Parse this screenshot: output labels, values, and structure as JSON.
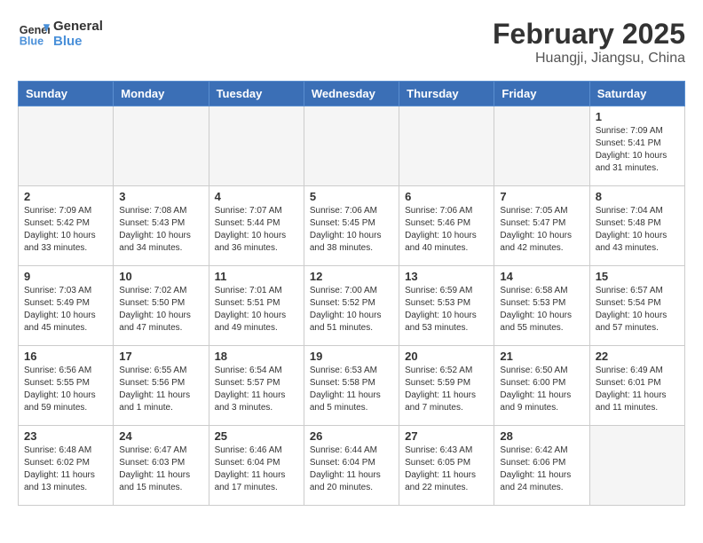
{
  "logo": {
    "line1": "General",
    "line2": "Blue"
  },
  "title": "February 2025",
  "subtitle": "Huangji, Jiangsu, China",
  "weekdays": [
    "Sunday",
    "Monday",
    "Tuesday",
    "Wednesday",
    "Thursday",
    "Friday",
    "Saturday"
  ],
  "weeks": [
    [
      {
        "day": "",
        "info": ""
      },
      {
        "day": "",
        "info": ""
      },
      {
        "day": "",
        "info": ""
      },
      {
        "day": "",
        "info": ""
      },
      {
        "day": "",
        "info": ""
      },
      {
        "day": "",
        "info": ""
      },
      {
        "day": "1",
        "info": "Sunrise: 7:09 AM\nSunset: 5:41 PM\nDaylight: 10 hours and 31 minutes."
      }
    ],
    [
      {
        "day": "2",
        "info": "Sunrise: 7:09 AM\nSunset: 5:42 PM\nDaylight: 10 hours and 33 minutes."
      },
      {
        "day": "3",
        "info": "Sunrise: 7:08 AM\nSunset: 5:43 PM\nDaylight: 10 hours and 34 minutes."
      },
      {
        "day": "4",
        "info": "Sunrise: 7:07 AM\nSunset: 5:44 PM\nDaylight: 10 hours and 36 minutes."
      },
      {
        "day": "5",
        "info": "Sunrise: 7:06 AM\nSunset: 5:45 PM\nDaylight: 10 hours and 38 minutes."
      },
      {
        "day": "6",
        "info": "Sunrise: 7:06 AM\nSunset: 5:46 PM\nDaylight: 10 hours and 40 minutes."
      },
      {
        "day": "7",
        "info": "Sunrise: 7:05 AM\nSunset: 5:47 PM\nDaylight: 10 hours and 42 minutes."
      },
      {
        "day": "8",
        "info": "Sunrise: 7:04 AM\nSunset: 5:48 PM\nDaylight: 10 hours and 43 minutes."
      }
    ],
    [
      {
        "day": "9",
        "info": "Sunrise: 7:03 AM\nSunset: 5:49 PM\nDaylight: 10 hours and 45 minutes."
      },
      {
        "day": "10",
        "info": "Sunrise: 7:02 AM\nSunset: 5:50 PM\nDaylight: 10 hours and 47 minutes."
      },
      {
        "day": "11",
        "info": "Sunrise: 7:01 AM\nSunset: 5:51 PM\nDaylight: 10 hours and 49 minutes."
      },
      {
        "day": "12",
        "info": "Sunrise: 7:00 AM\nSunset: 5:52 PM\nDaylight: 10 hours and 51 minutes."
      },
      {
        "day": "13",
        "info": "Sunrise: 6:59 AM\nSunset: 5:53 PM\nDaylight: 10 hours and 53 minutes."
      },
      {
        "day": "14",
        "info": "Sunrise: 6:58 AM\nSunset: 5:53 PM\nDaylight: 10 hours and 55 minutes."
      },
      {
        "day": "15",
        "info": "Sunrise: 6:57 AM\nSunset: 5:54 PM\nDaylight: 10 hours and 57 minutes."
      }
    ],
    [
      {
        "day": "16",
        "info": "Sunrise: 6:56 AM\nSunset: 5:55 PM\nDaylight: 10 hours and 59 minutes."
      },
      {
        "day": "17",
        "info": "Sunrise: 6:55 AM\nSunset: 5:56 PM\nDaylight: 11 hours and 1 minute."
      },
      {
        "day": "18",
        "info": "Sunrise: 6:54 AM\nSunset: 5:57 PM\nDaylight: 11 hours and 3 minutes."
      },
      {
        "day": "19",
        "info": "Sunrise: 6:53 AM\nSunset: 5:58 PM\nDaylight: 11 hours and 5 minutes."
      },
      {
        "day": "20",
        "info": "Sunrise: 6:52 AM\nSunset: 5:59 PM\nDaylight: 11 hours and 7 minutes."
      },
      {
        "day": "21",
        "info": "Sunrise: 6:50 AM\nSunset: 6:00 PM\nDaylight: 11 hours and 9 minutes."
      },
      {
        "day": "22",
        "info": "Sunrise: 6:49 AM\nSunset: 6:01 PM\nDaylight: 11 hours and 11 minutes."
      }
    ],
    [
      {
        "day": "23",
        "info": "Sunrise: 6:48 AM\nSunset: 6:02 PM\nDaylight: 11 hours and 13 minutes."
      },
      {
        "day": "24",
        "info": "Sunrise: 6:47 AM\nSunset: 6:03 PM\nDaylight: 11 hours and 15 minutes."
      },
      {
        "day": "25",
        "info": "Sunrise: 6:46 AM\nSunset: 6:04 PM\nDaylight: 11 hours and 17 minutes."
      },
      {
        "day": "26",
        "info": "Sunrise: 6:44 AM\nSunset: 6:04 PM\nDaylight: 11 hours and 20 minutes."
      },
      {
        "day": "27",
        "info": "Sunrise: 6:43 AM\nSunset: 6:05 PM\nDaylight: 11 hours and 22 minutes."
      },
      {
        "day": "28",
        "info": "Sunrise: 6:42 AM\nSunset: 6:06 PM\nDaylight: 11 hours and 24 minutes."
      },
      {
        "day": "",
        "info": ""
      }
    ]
  ]
}
